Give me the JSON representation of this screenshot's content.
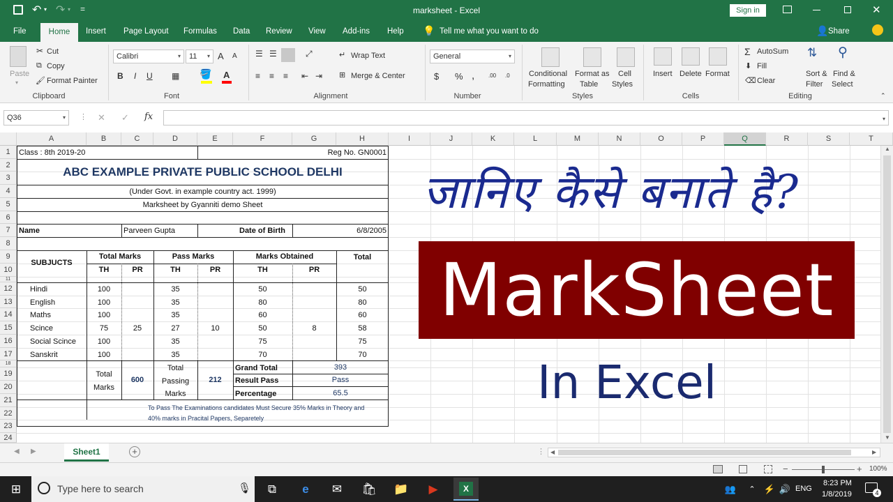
{
  "title_bar": {
    "title": "marksheet - Excel",
    "sign_in": "Sign in",
    "qat_dropdown": "="
  },
  "ribbon_tabs": [
    "File",
    "Home",
    "Insert",
    "Page Layout",
    "Formulas",
    "Data",
    "Review",
    "View",
    "Add-ins",
    "Help"
  ],
  "tell_me": "Tell me what you want to do",
  "share": "Share",
  "clipboard": {
    "paste": "Paste",
    "cut": "Cut",
    "copy": "Copy",
    "format_painter": "Format Painter",
    "label": "Clipboard"
  },
  "font": {
    "name": "Calibri",
    "size": "11",
    "bold": "B",
    "italic": "I",
    "underline": "U",
    "grow": "A",
    "shrink": "A",
    "color": "A",
    "label": "Font"
  },
  "alignment": {
    "wrap": "Wrap Text",
    "merge": "Merge & Center",
    "label": "Alignment"
  },
  "number": {
    "format": "General",
    "currency": "$",
    "percent": "%",
    "comma": ",",
    "inc": ".00",
    "dec": ".0",
    "label": "Number"
  },
  "styles": {
    "cond": "Conditional",
    "cond2": "Formatting",
    "fmt_table": "Format as",
    "fmt_table2": "Table",
    "cell": "Cell",
    "cell2": "Styles",
    "label": "Styles"
  },
  "cells": {
    "insert": "Insert",
    "delete": "Delete",
    "format": "Format",
    "label": "Cells"
  },
  "editing": {
    "autosum": "AutoSum",
    "fill": "Fill",
    "clear": "Clear",
    "sort": "Sort &",
    "sort2": "Filter",
    "find": "Find &",
    "find2": "Select",
    "label": "Editing"
  },
  "formula_bar": {
    "name_box": "Q36",
    "fx": "fx",
    "cancel": "✕",
    "enter": "✓",
    "value": ""
  },
  "columns": [
    "A",
    "B",
    "C",
    "D",
    "E",
    "F",
    "G",
    "H",
    "I",
    "J",
    "K",
    "L",
    "M",
    "N",
    "O",
    "P",
    "Q",
    "R",
    "S",
    "T"
  ],
  "rows": [
    "1",
    "2",
    "3",
    "4",
    "5",
    "6",
    "7",
    "8",
    "9",
    "10",
    "11",
    "12",
    "13",
    "14",
    "15",
    "16",
    "17",
    "18",
    "19",
    "20",
    "21",
    "22",
    "23",
    "24"
  ],
  "sheet": {
    "class": "Class : 8th 2019-20",
    "reg": "Reg No. GN0001",
    "school": "ABC EXAMPLE PRIVATE PUBLIC SCHOOL DELHI",
    "under": "(Under Govt. in example country act. 1999)",
    "marksheet_by": "Marksheet by Gyanniti demo Sheet",
    "name_label": "Name",
    "name_value": "Parveen Gupta",
    "dob_label": "Date of Birth",
    "dob_value": "6/8/2005",
    "subjects_hdr": "SUBJUCTS",
    "total_marks_hdr": "Total Marks",
    "pass_marks_hdr": "Pass Marks",
    "marks_obt_hdr": "Marks Obtained",
    "total_hdr": "Total",
    "th": "TH",
    "pr": "PR",
    "subjects": [
      {
        "name": "Hindi",
        "tm_th": "100",
        "tm_pr": "",
        "pm_th": "35",
        "pm_pr": "",
        "mo_th": "50",
        "mo_pr": "",
        "total": "50"
      },
      {
        "name": "English",
        "tm_th": "100",
        "tm_pr": "",
        "pm_th": "35",
        "pm_pr": "",
        "mo_th": "80",
        "mo_pr": "",
        "total": "80"
      },
      {
        "name": "Maths",
        "tm_th": "100",
        "tm_pr": "",
        "pm_th": "35",
        "pm_pr": "",
        "mo_th": "60",
        "mo_pr": "",
        "total": "60"
      },
      {
        "name": "Scince",
        "tm_th": "75",
        "tm_pr": "25",
        "pm_th": "27",
        "pm_pr": "10",
        "mo_th": "50",
        "mo_pr": "8",
        "total": "58"
      },
      {
        "name": "Social Scince",
        "tm_th": "100",
        "tm_pr": "",
        "pm_th": "35",
        "pm_pr": "",
        "mo_th": "75",
        "mo_pr": "",
        "total": "75"
      },
      {
        "name": "Sanskrit",
        "tm_th": "100",
        "tm_pr": "",
        "pm_th": "35",
        "pm_pr": "",
        "mo_th": "70",
        "mo_pr": "",
        "total": "70"
      }
    ],
    "total_l1": "Total",
    "total_l2": "Marks",
    "total_marks_value": "600",
    "passing_l1": "Total",
    "passing_l2": "Passing",
    "passing_l3": "Marks",
    "passing_value": "212",
    "grand_total_label": "Grand Total",
    "grand_total_value": "393",
    "result_label": "Result Pass",
    "result_value": "Pass",
    "percentage_label": "Percentage",
    "percentage_value": "65.5",
    "note_l1": "To Pass The Examinations candidates Must Secure 35% Marks in Theory and",
    "note_l2": "40% marks in Pracital Papers, Separetely"
  },
  "overlay": {
    "hindi": "जानिए कैसे बनाते है?",
    "title": "MarkSheet",
    "subtitle": "In Excel"
  },
  "sheet_tab": "Sheet1",
  "add_sheet": "+",
  "zoom": "100%",
  "taskbar": {
    "search": "Type here to search",
    "lang": "ENG",
    "time": "8:23 PM",
    "date": "1/8/2019",
    "notif_count": "4"
  },
  "colors": {
    "excel_green": "#217346",
    "maroon": "#800000",
    "navy": "#1a2a8f"
  }
}
